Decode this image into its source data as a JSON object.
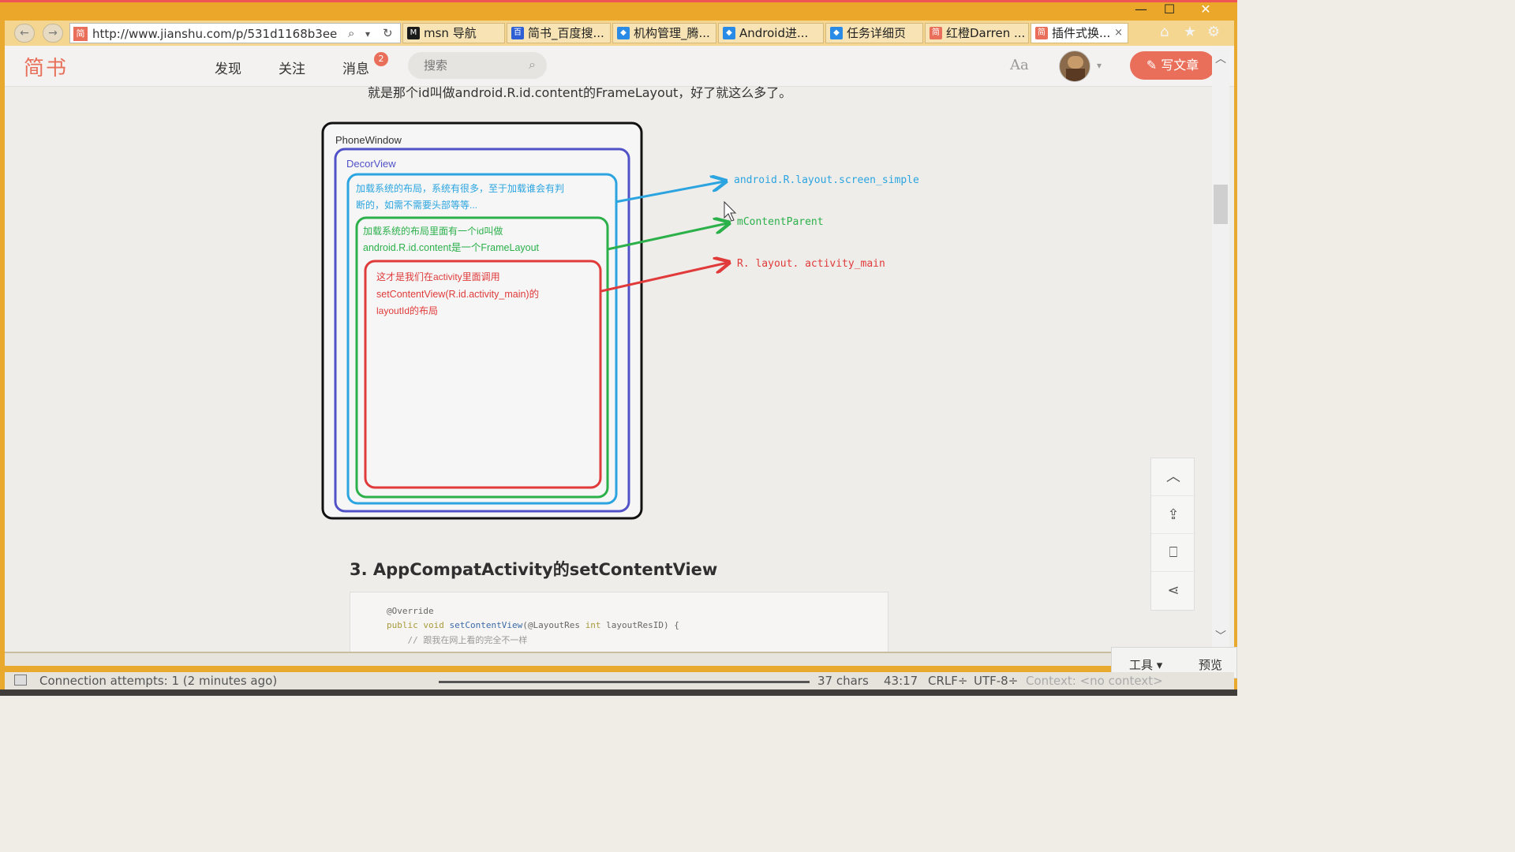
{
  "window": {
    "minimize": "—",
    "maximize": "☐",
    "close": "✕"
  },
  "browser": {
    "back": "←",
    "forward": "→",
    "url": "http://www.jianshu.com/p/531d1168b3ee",
    "url_fav": "简",
    "search_icon": "⌕",
    "dropdown": "▾",
    "refresh": "↻",
    "tabs": [
      {
        "label": "msn 导航",
        "fav": "M",
        "color": "#1b1b1b"
      },
      {
        "label": "简书_百度搜...",
        "fav": "百",
        "color": "#2e5fd4"
      },
      {
        "label": "机构管理_腾...",
        "fav": "◆",
        "color": "#2a8be6"
      },
      {
        "label": "Android进...",
        "fav": "◆",
        "color": "#2a8be6"
      },
      {
        "label": "任务详细页",
        "fav": "◆",
        "color": "#2a8be6"
      },
      {
        "label": "红橙Darren ...",
        "fav": "简",
        "color": "#ea6f5a"
      },
      {
        "label": "插件式换...",
        "fav": "简",
        "color": "#ea6f5a"
      }
    ],
    "tab_close": "×",
    "home_icon": "⌂",
    "star_icon": "★",
    "gear_icon": "⚙"
  },
  "site": {
    "logo": "简书",
    "nav": [
      "发现",
      "关注",
      "消息"
    ],
    "message_badge": "2",
    "search_placeholder": "搜索",
    "search_icon": "⌕",
    "font_toggle": "Aa",
    "avatar_caret": "▾",
    "write_button": "✎ 写文章"
  },
  "article": {
    "intro": "就是那个id叫做android.R.id.content的FrameLayout，好了就这么多了。",
    "diagram": {
      "phone_window": "PhoneWindow",
      "decor_view": "DecorView",
      "blue_text_1": "加载系统的布局，系统有很多，至于加载谁会有判",
      "blue_text_2": "断的，如需不需要头部等等...",
      "green_text_1": "加载系统的布局里面有一个id叫做",
      "green_text_2": "android.R.id.content是一个FrameLayout",
      "red_text_1": "这才是我们在activity里面调用",
      "red_text_2": "setContentView(R.id.activity_main)的",
      "red_text_3": "layoutId的布局",
      "label_blue": "android.R.layout.screen_simple",
      "label_green": "mContentParent",
      "label_red": "R. layout. activity_main",
      "colors": {
        "blue": "#2ba4e0",
        "green": "#2bb04a",
        "red": "#e03a3a",
        "purple": "#5252c8",
        "black": "#111111"
      }
    },
    "section_heading": "3. AppCompatActivity的setContentView",
    "code": {
      "line1": "@Override",
      "line2_kw": "public void ",
      "line2_fn": "setContentView",
      "line2_rest": "(@LayoutRes ",
      "line2_kw2": "int",
      "line2_end": " layoutResID) {",
      "line3": "    // 跟我在网上看的完全不一样"
    }
  },
  "side_tools": {
    "up": "︿",
    "share_up": "⇪",
    "bookmark": "⎕",
    "share": "⋖"
  },
  "scroll": {
    "up": "︿",
    "down": "﹀"
  },
  "editor": {
    "tools": "工具 ▾",
    "preview": "预览"
  },
  "status": {
    "connection": "Connection attempts: 1 (2 minutes ago)",
    "chars": "37 chars",
    "position": "43:17",
    "line_ending": "CRLF÷",
    "encoding": "UTF-8÷",
    "context": "Context: <no context>"
  }
}
